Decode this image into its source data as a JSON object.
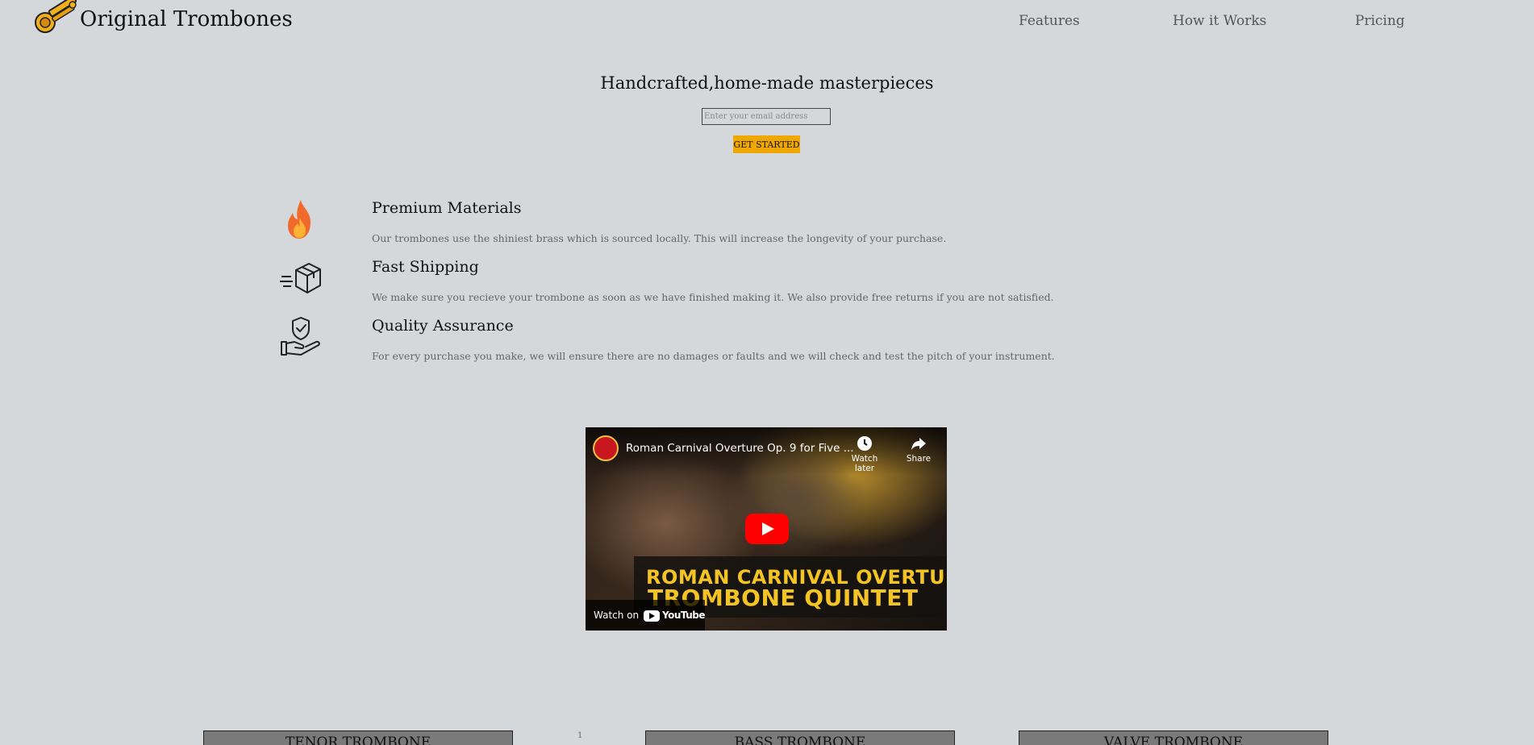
{
  "header": {
    "brand": "Original Trombones",
    "nav": [
      "Features",
      "How it Works",
      "Pricing"
    ]
  },
  "hero": {
    "title": "Handcrafted,home-made masterpieces",
    "email_placeholder": "Enter your email address",
    "cta_label": "GET STARTED"
  },
  "features": [
    {
      "icon": "fire-icon",
      "title": "Premium Materials",
      "description": "Our trombones use the shiniest brass which is sourced locally. This will increase the longevity of your purchase."
    },
    {
      "icon": "shipping-box-icon",
      "title": "Fast Shipping",
      "description": "We make sure you recieve your trombone as soon as we have finished making it. We also provide free returns if you are not satisfied."
    },
    {
      "icon": "shield-hand-icon",
      "title": "Quality Assurance",
      "description": "For every purchase you make, we will ensure there are no damages or faults and we will check and test the pitch of your instrument."
    }
  ],
  "video": {
    "title": "Roman Carnival Overture Op. 9 for Five ...",
    "watch_later": "Watch later",
    "share": "Share",
    "banner_line1": "ROMAN CARNIVAL OVERTURE",
    "banner_line2": "TROMBONE QUINTET",
    "watch_on": "Watch on",
    "youtube": "YouTube"
  },
  "pricing": {
    "marker": "1",
    "cards": [
      "TENOR TROMBONE",
      "BASS TROMBONE",
      "VALVE TROMBONE"
    ]
  },
  "colors": {
    "background": "#d4d8da",
    "accent": "#f0a800",
    "card": "#7a7a7a"
  }
}
